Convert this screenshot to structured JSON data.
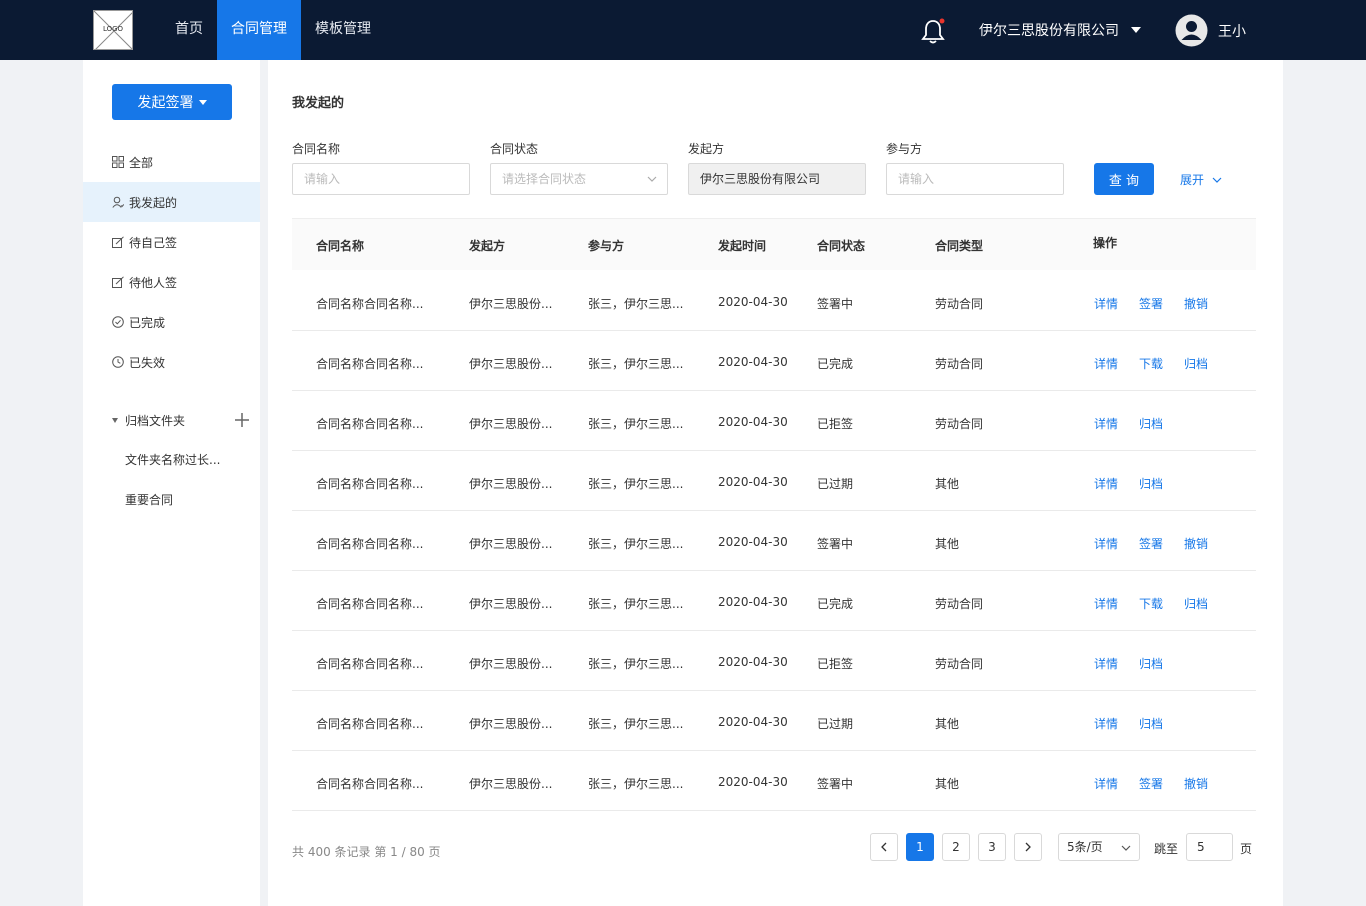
{
  "header": {
    "logo_text": "LOGO",
    "nav": [
      {
        "label": "首页",
        "active": false
      },
      {
        "label": "合同管理",
        "active": true
      },
      {
        "label": "模板管理",
        "active": false
      }
    ],
    "company": "伊尔三思股份有限公司",
    "user": "王小",
    "bell_icon": "bell-icon",
    "accent_color": "#1677e8",
    "topbar_color": "#0b1a33"
  },
  "sidebar": {
    "initiate_button": "发起签署",
    "items": [
      {
        "label": "全部",
        "icon": "grid-icon"
      },
      {
        "label": "我发起的",
        "icon": "user-icon",
        "active": true
      },
      {
        "label": "待自己签",
        "icon": "sign-icon"
      },
      {
        "label": "待他人签",
        "icon": "sign-icon"
      },
      {
        "label": "已完成",
        "icon": "check-circle-icon"
      },
      {
        "label": "已失效",
        "icon": "clock-icon"
      }
    ],
    "folder_header": "归档文件夹",
    "folders": [
      "文件夹名称过长...",
      "重要合同"
    ]
  },
  "main": {
    "title": "我发起的",
    "filters": {
      "name_label": "合同名称",
      "name_placeholder": "请输入",
      "status_label": "合同状态",
      "status_placeholder": "请选择合同状态",
      "initiator_label": "发起方",
      "initiator_value": "伊尔三思股份有限公司",
      "participant_label": "参与方",
      "participant_placeholder": "请输入",
      "query_button": "查 询",
      "expand_label": "展开"
    },
    "table": {
      "headers": [
        "合同名称",
        "发起方",
        "参与方",
        "发起时间",
        "合同状态",
        "合同类型",
        "操作"
      ],
      "rows": [
        {
          "name": "合同名称合同名称...",
          "initiator": "伊尔三思股份...",
          "participants": "张三，伊尔三思...",
          "date": "2020-04-30",
          "status": "签署中",
          "type": "劳动合同",
          "actions": [
            "详情",
            "签署",
            "撤销"
          ]
        },
        {
          "name": "合同名称合同名称...",
          "initiator": "伊尔三思股份...",
          "participants": "张三，伊尔三思...",
          "date": "2020-04-30",
          "status": "已完成",
          "type": "劳动合同",
          "actions": [
            "详情",
            "下载",
            "归档"
          ]
        },
        {
          "name": "合同名称合同名称...",
          "initiator": "伊尔三思股份...",
          "participants": "张三，伊尔三思...",
          "date": "2020-04-30",
          "status": "已拒签",
          "type": "劳动合同",
          "actions": [
            "详情",
            "归档"
          ]
        },
        {
          "name": "合同名称合同名称...",
          "initiator": "伊尔三思股份...",
          "participants": "张三，伊尔三思...",
          "date": "2020-04-30",
          "status": "已过期",
          "type": "其他",
          "actions": [
            "详情",
            "归档"
          ]
        },
        {
          "name": "合同名称合同名称...",
          "initiator": "伊尔三思股份...",
          "participants": "张三，伊尔三思...",
          "date": "2020-04-30",
          "status": "签署中",
          "type": "其他",
          "actions": [
            "详情",
            "签署",
            "撤销"
          ]
        },
        {
          "name": "合同名称合同名称...",
          "initiator": "伊尔三思股份...",
          "participants": "张三，伊尔三思...",
          "date": "2020-04-30",
          "status": "已完成",
          "type": "劳动合同",
          "actions": [
            "详情",
            "下载",
            "归档"
          ]
        },
        {
          "name": "合同名称合同名称...",
          "initiator": "伊尔三思股份...",
          "participants": "张三，伊尔三思...",
          "date": "2020-04-30",
          "status": "已拒签",
          "type": "劳动合同",
          "actions": [
            "详情",
            "归档"
          ]
        },
        {
          "name": "合同名称合同名称...",
          "initiator": "伊尔三思股份...",
          "participants": "张三，伊尔三思...",
          "date": "2020-04-30",
          "status": "已过期",
          "type": "其他",
          "actions": [
            "详情",
            "归档"
          ]
        },
        {
          "name": "合同名称合同名称...",
          "initiator": "伊尔三思股份...",
          "participants": "张三，伊尔三思...",
          "date": "2020-04-30",
          "status": "签署中",
          "type": "其他",
          "actions": [
            "详情",
            "签署",
            "撤销"
          ]
        }
      ]
    },
    "pagination": {
      "info": "共 400 条记录 第 1 / 80 页",
      "pages": [
        "1",
        "2",
        "3"
      ],
      "current": "1",
      "page_size": "5条/页",
      "jump_label": "跳至",
      "jump_value": "5",
      "jump_suffix": "页"
    }
  }
}
